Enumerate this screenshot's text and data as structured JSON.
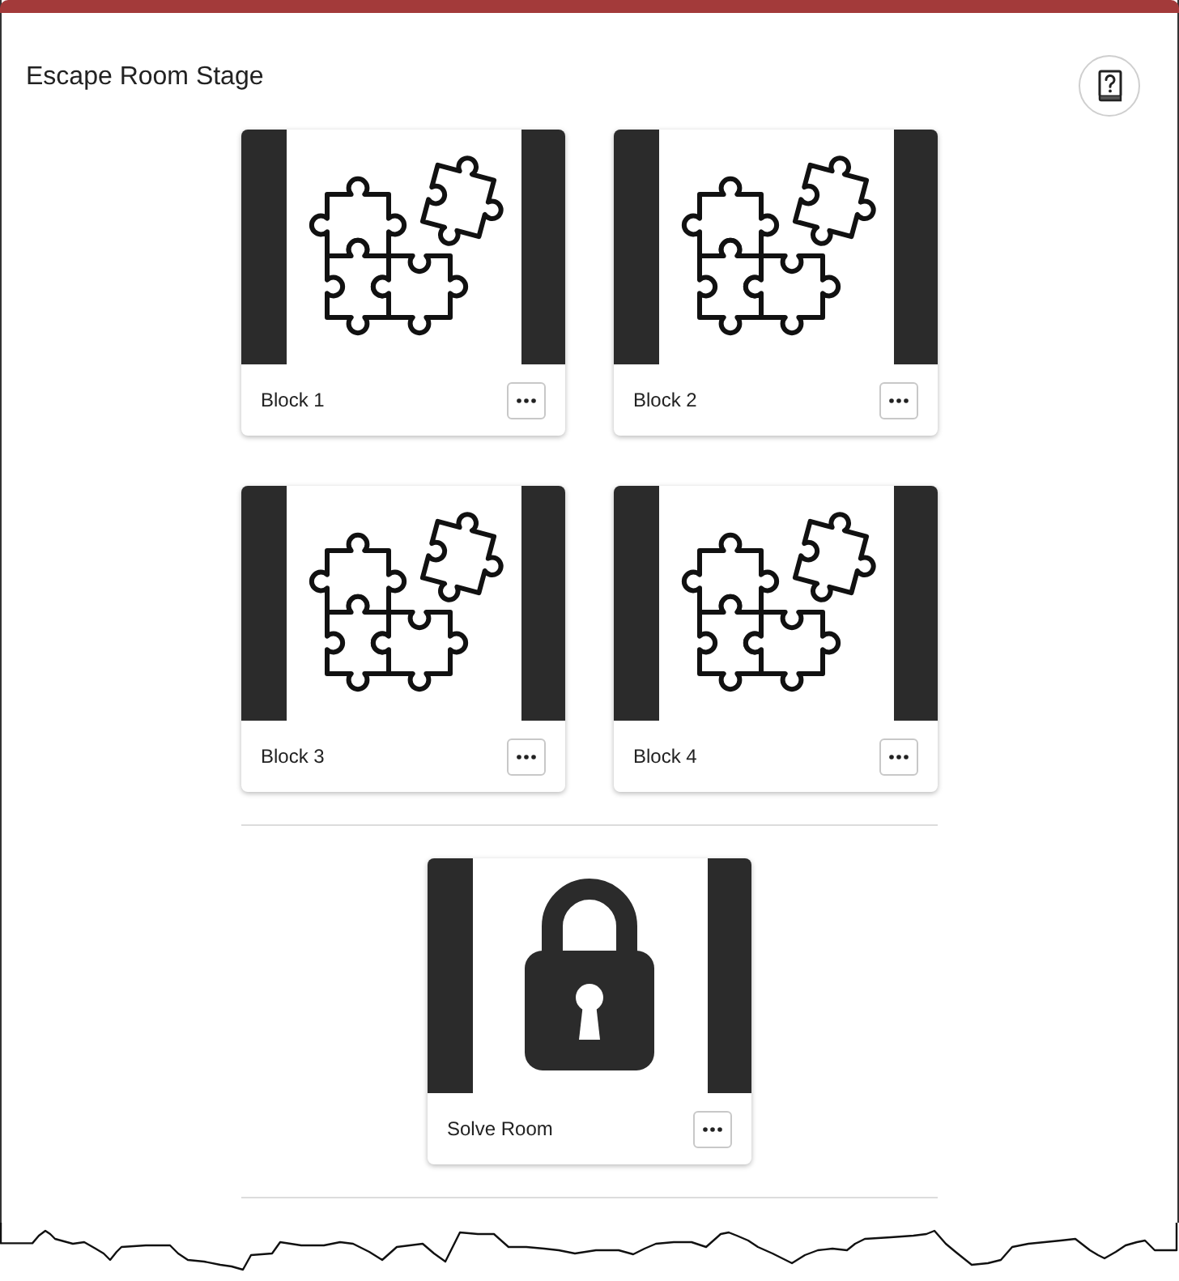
{
  "panel": {
    "title": "Escape Room Stage"
  },
  "sections": [
    {
      "blocks": [
        {
          "label": "Block 1",
          "kind": "puzzle"
        },
        {
          "label": "Block 2",
          "kind": "puzzle"
        },
        {
          "label": "Block 3",
          "kind": "puzzle"
        },
        {
          "label": "Block 4",
          "kind": "puzzle"
        }
      ]
    },
    {
      "blocks": [
        {
          "label": "Solve Room",
          "kind": "lock"
        }
      ]
    }
  ]
}
